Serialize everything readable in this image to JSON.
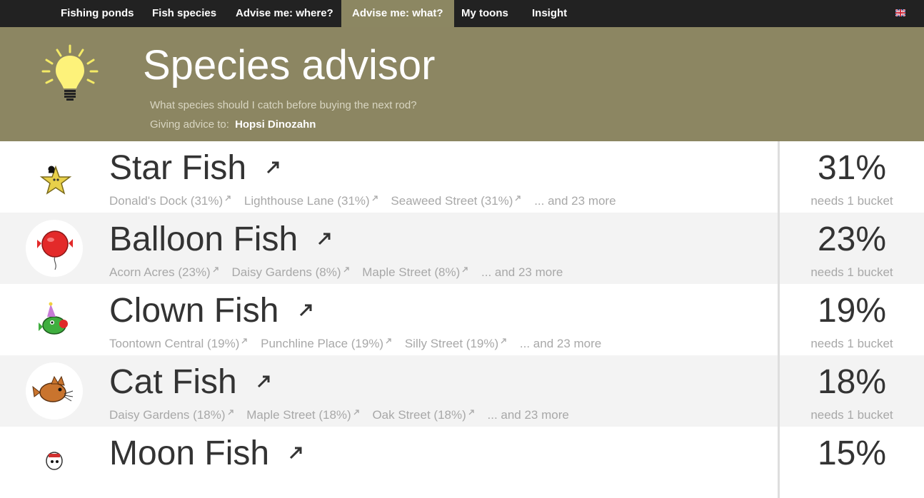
{
  "nav": {
    "items": [
      {
        "label": "Fishing ponds"
      },
      {
        "label": "Fish species"
      },
      {
        "label": "Advise me: where?"
      },
      {
        "label": "Advise me: what?"
      },
      {
        "label": "My toons"
      },
      {
        "label": "Insight"
      }
    ],
    "active_item": "Advise me: what?",
    "language_icon": "uk-flag-icon"
  },
  "header": {
    "icon": "light-bulb-icon",
    "title": "Species advisor",
    "subtitle": "What species should I catch before buying the next rod?",
    "advice_label": "Giving advice to:",
    "advice_name": "Hopsi Dinozahn"
  },
  "colors": {
    "nav_bg": "#222222",
    "header_bg": "#8c8662",
    "active_tab": "#8c8762",
    "row_alt": "#f3f3f3"
  },
  "species": [
    {
      "name": "Star Fish",
      "icon": "star-fish-icon",
      "ponds": [
        "Donald's Dock (31%)",
        "Lighthouse Lane (31%)",
        "Seaweed Street (31%)"
      ],
      "more": "... and 23 more",
      "percent": "31%",
      "needs": "needs 1 bucket"
    },
    {
      "name": "Balloon Fish",
      "icon": "balloon-fish-icon",
      "ponds": [
        "Acorn Acres (23%)",
        "Daisy Gardens (8%)",
        "Maple Street (8%)"
      ],
      "more": "... and 23 more",
      "percent": "23%",
      "needs": "needs 1 bucket"
    },
    {
      "name": "Clown Fish",
      "icon": "clown-fish-icon",
      "ponds": [
        "Toontown Central (19%)",
        "Punchline Place (19%)",
        "Silly Street (19%)"
      ],
      "more": "... and 23 more",
      "percent": "19%",
      "needs": "needs 1 bucket"
    },
    {
      "name": "Cat Fish",
      "icon": "cat-fish-icon",
      "ponds": [
        "Daisy Gardens (18%)",
        "Maple Street (18%)",
        "Oak Street (18%)"
      ],
      "more": "... and 23 more",
      "percent": "18%",
      "needs": "needs 1 bucket"
    },
    {
      "name": "Moon Fish",
      "icon": "moon-fish-icon",
      "ponds": [],
      "more": "",
      "percent": "15%",
      "needs": ""
    }
  ]
}
